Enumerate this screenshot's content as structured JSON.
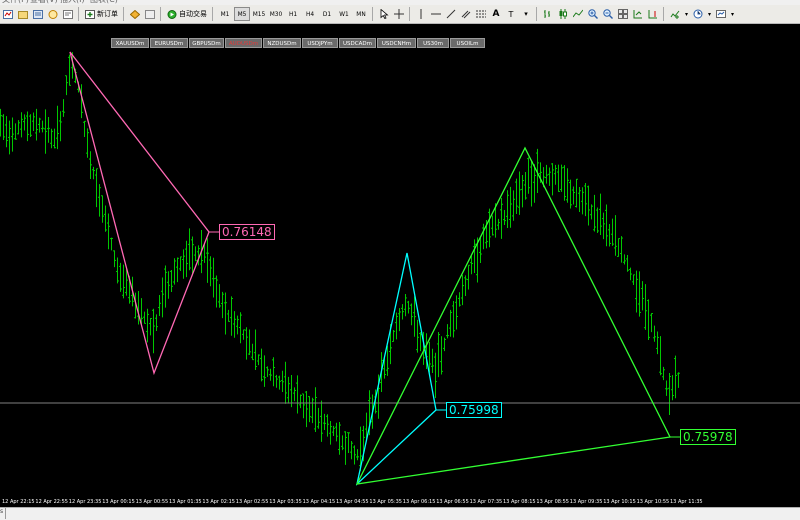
{
  "toolbar": {
    "new_order_label": "新订单",
    "autotrade_label": "自动交易",
    "timeframes": [
      "M1",
      "M5",
      "M15",
      "M30",
      "H1",
      "H4",
      "D1",
      "W1",
      "MN"
    ]
  },
  "symbol_tabs": [
    "XAUUSDm",
    "EURUSDm",
    "GBPUSDm",
    "AUDUSDm",
    "NZDUSDm",
    "USDJPYm",
    "USDCADm",
    "USDCNHm",
    "US30m",
    "USOILm"
  ],
  "active_symbol": "AUDUSDm",
  "price_labels": {
    "pink": "0.76148",
    "cyan": "0.75998",
    "green": "0.75978"
  },
  "time_axis": [
    "12 Apr 22:15",
    "12 Apr 22:55",
    "12 Apr 23:35",
    "13 Apr 00:15",
    "13 Apr 00:55",
    "13 Apr 01:35",
    "13 Apr 02:15",
    "13 Apr 02:55",
    "13 Apr 03:35",
    "13 Apr 04:15",
    "13 Apr 04:55",
    "13 Apr 05:35",
    "13 Apr 06:15",
    "13 Apr 06:55",
    "13 Apr 07:35",
    "13 Apr 08:15",
    "13 Apr 08:55",
    "13 Apr 09:35",
    "13 Apr 10:15",
    "13 Apr 10:55",
    "13 Apr 11:35"
  ],
  "colors": {
    "bars": "#00c800",
    "pink_pattern": "#ff69b4",
    "cyan_pattern": "#00ffff",
    "green_pattern": "#32ff32",
    "bid_line": "#808080"
  },
  "patterns": {
    "pink": [
      [
        0.76475,
        "12 Apr 23:35"
      ],
      [
        0.75965,
        "13 Apr 00:55"
      ],
      [
        0.76148,
        "13 Apr 02:15"
      ]
    ],
    "cyan": [
      [
        0.75877,
        "13 Apr 04:55"
      ],
      [
        0.76076,
        "13 Apr 05:35"
      ],
      [
        0.75998,
        "13 Apr 06:15"
      ]
    ],
    "green": [
      [
        0.75877,
        "13 Apr 04:55"
      ],
      [
        0.76286,
        "13 Apr 08:15"
      ],
      [
        0.75978,
        "13 Apr 10:55"
      ]
    ]
  }
}
